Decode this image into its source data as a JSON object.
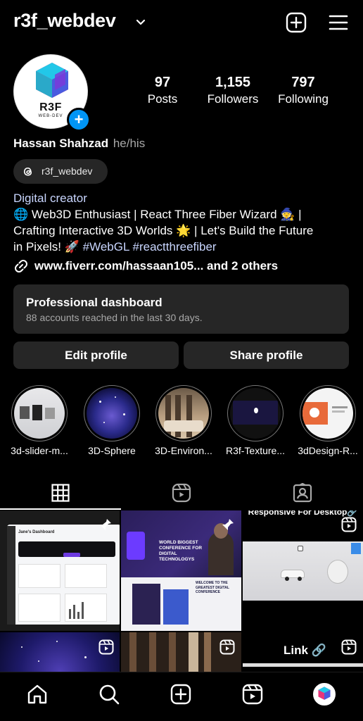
{
  "header": {
    "username": "r3f_webdev"
  },
  "profile": {
    "stats": [
      {
        "number": "97",
        "label": "Posts"
      },
      {
        "number": "1,155",
        "label": "Followers"
      },
      {
        "number": "797",
        "label": "Following"
      }
    ],
    "avatar_text": "R3F",
    "avatar_subtext": "WEB-DEV",
    "name": "Hassan Shahzad",
    "pronouns": "he/his",
    "threads_handle": "r3f_webdev",
    "category": "Digital creator",
    "bio_line1": "🌐 Web3D Enthusiast | React Three Fiber Wizard 🧙 |",
    "bio_line2": "Crafting Interactive 3D Worlds 🌟 | Let's Build the Future",
    "bio_line3_prefix": "in Pixels! 🚀 ",
    "bio_tag1": "#WebGL",
    "bio_tag2": "#reactthreefiber",
    "link_text": "www.fiverr.com/hassaan105...  and 2 others"
  },
  "dashboard": {
    "title": "Professional dashboard",
    "subtitle": "88 accounts reached in the last 30 days."
  },
  "buttons": {
    "edit": "Edit profile",
    "share": "Share profile"
  },
  "highlights": [
    {
      "label": "3d-slider-m..."
    },
    {
      "label": "3D-Sphere"
    },
    {
      "label": "3D-Environ..."
    },
    {
      "label": "R3f-Texture..."
    },
    {
      "label": "3dDesign-R..."
    }
  ],
  "posts": {
    "p1_title": "Jane's Dashboard",
    "p2_headline": "WORLD BIGGEST CONFERENCE FOR DIGITAL TECHNOLOGYS",
    "p2_sub": "WELCOME TO THE GREATEST DIGITAL CONFERENCE",
    "p3_caption": "Responsive For Desktop🔗",
    "p6_caption": "Link 🔗"
  },
  "colors": {
    "accent": "#0095f6",
    "surface": "#262626",
    "secondary_text": "#a8a8a8"
  }
}
